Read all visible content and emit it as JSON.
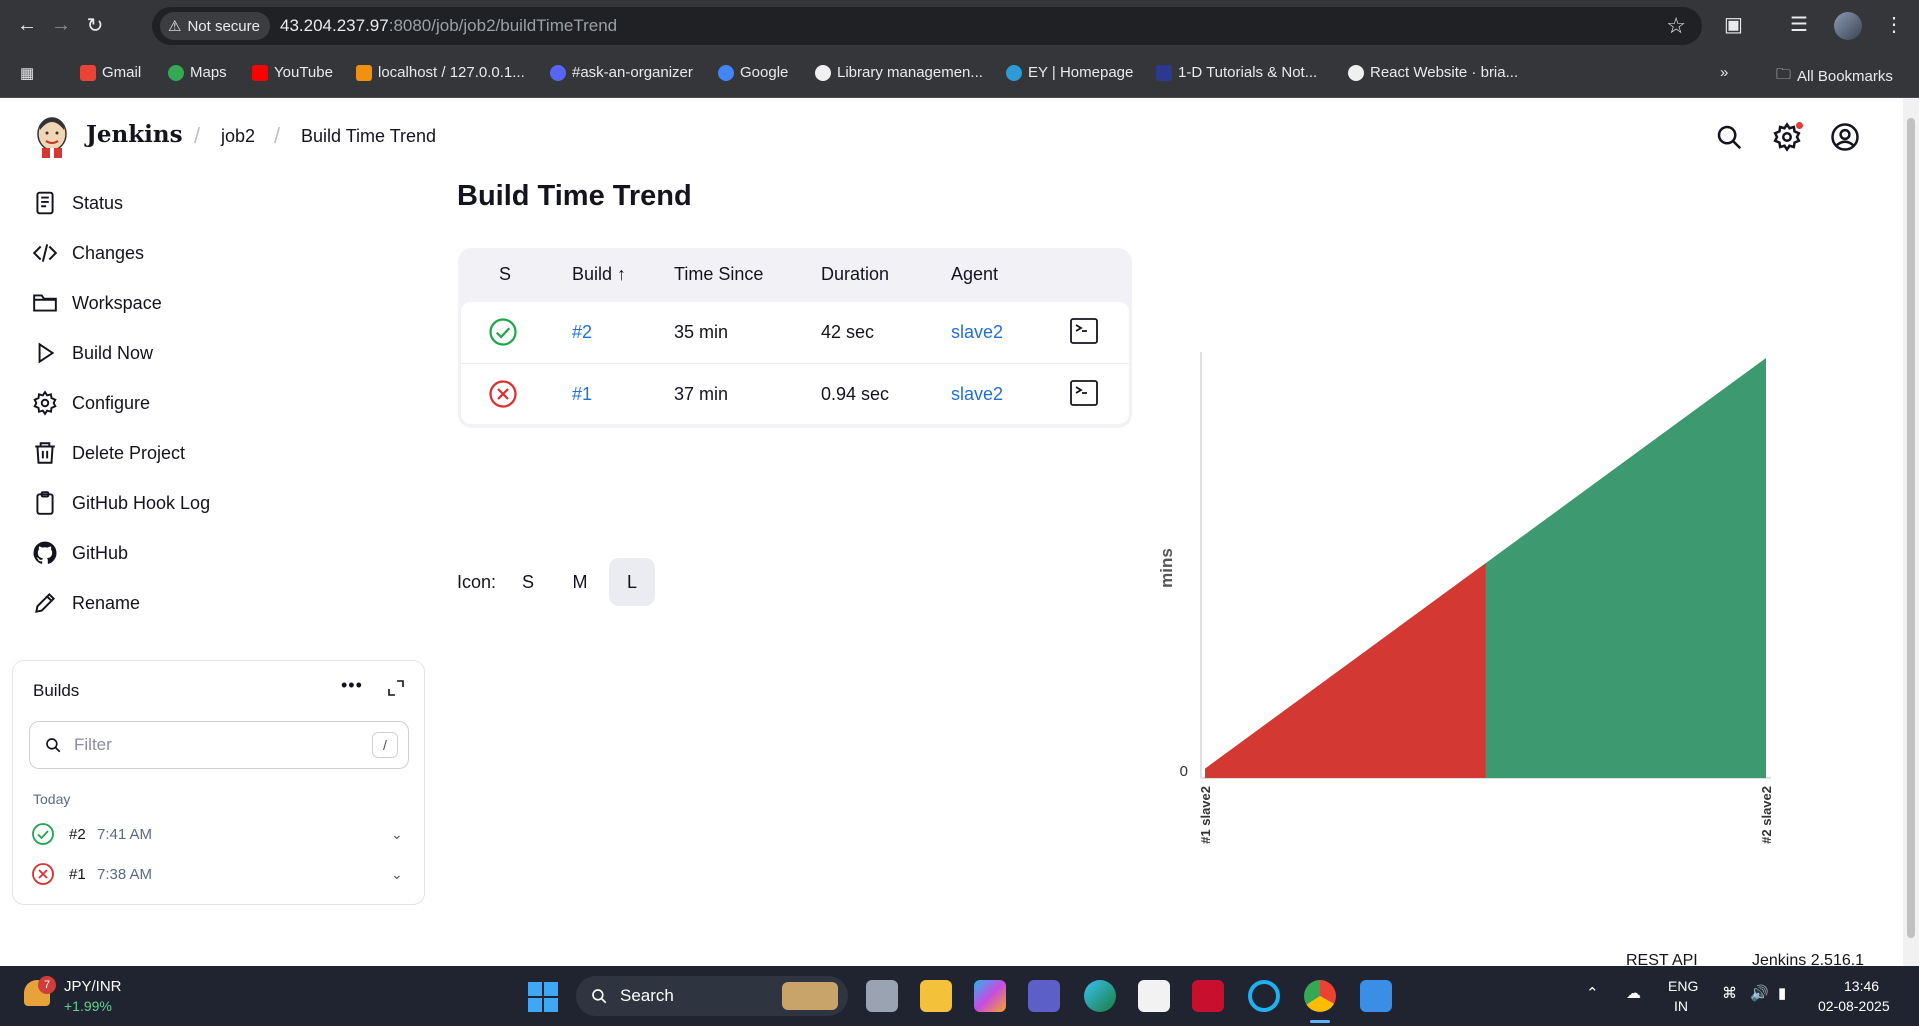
{
  "browser": {
    "security_label": "Not secure",
    "url_host": "43.204.237.97",
    "url_path": ":8080/job/job2/buildTimeTrend",
    "bookmarks": [
      {
        "label": "Gmail"
      },
      {
        "label": "Maps"
      },
      {
        "label": "YouTube"
      },
      {
        "label": "localhost / 127.0.0.1..."
      },
      {
        "label": "#ask-an-organizer"
      },
      {
        "label": "Google"
      },
      {
        "label": "Library managemen..."
      },
      {
        "label": "EY | Homepage"
      },
      {
        "label": "1-D Tutorials & Not..."
      },
      {
        "label": "React Website · bria..."
      }
    ],
    "more_bookmarks": "»",
    "all_bookmarks": "All Bookmarks"
  },
  "header": {
    "brand": "Jenkins",
    "breadcrumbs": [
      "job2",
      "Build Time Trend"
    ]
  },
  "sidebar": {
    "items": [
      {
        "label": "Status",
        "icon": "document-icon"
      },
      {
        "label": "Changes",
        "icon": "code-icon"
      },
      {
        "label": "Workspace",
        "icon": "folder-icon"
      },
      {
        "label": "Build Now",
        "icon": "play-icon"
      },
      {
        "label": "Configure",
        "icon": "gear-icon"
      },
      {
        "label": "Delete Project",
        "icon": "trash-icon"
      },
      {
        "label": "GitHub Hook Log",
        "icon": "clipboard-icon"
      },
      {
        "label": "GitHub",
        "icon": "github-icon"
      },
      {
        "label": "Rename",
        "icon": "pencil-icon"
      }
    ]
  },
  "builds_panel": {
    "title": "Builds",
    "more": "•••",
    "filter_placeholder": "Filter",
    "filter_shortcut": "/",
    "group": "Today",
    "builds": [
      {
        "number": "#2",
        "time": "7:41 AM",
        "status": "success"
      },
      {
        "number": "#1",
        "time": "7:38 AM",
        "status": "failure"
      }
    ]
  },
  "main": {
    "title": "Build Time Trend",
    "columns": [
      "S",
      "Build ↑",
      "Time Since",
      "Duration",
      "Agent"
    ],
    "rows": [
      {
        "status": "success",
        "build": "#2",
        "time_since": "35 min",
        "duration": "42 sec",
        "agent": "slave2"
      },
      {
        "status": "failure",
        "build": "#1",
        "time_since": "37 min",
        "duration": "0.94 sec",
        "agent": "slave2"
      }
    ],
    "icon_size_label": "Icon:",
    "icon_sizes": [
      "S",
      "M",
      "L"
    ],
    "icon_size_selected": "L"
  },
  "chart_data": {
    "type": "area",
    "ylabel": "mins",
    "x": [
      "#1 slave2",
      "#2 slave2"
    ],
    "y_tick_labels": [
      "0"
    ],
    "series": [
      {
        "values": [
          0.0157,
          0.7
        ],
        "colors": [
          "#d33833",
          "#3d9970"
        ]
      }
    ],
    "colors": {
      "failure": "#d33833",
      "success": "#3d9970"
    }
  },
  "footer": {
    "rest_api": "REST API",
    "version": "Jenkins 2.516.1"
  },
  "taskbar": {
    "ticker_badge": "7",
    "ticker_name": "JPY/INR",
    "ticker_change": "+1.99%",
    "search_label": "Search",
    "lang_line1": "ENG",
    "lang_line2": "IN",
    "clock_time": "13:46",
    "clock_date": "02-08-2025"
  }
}
